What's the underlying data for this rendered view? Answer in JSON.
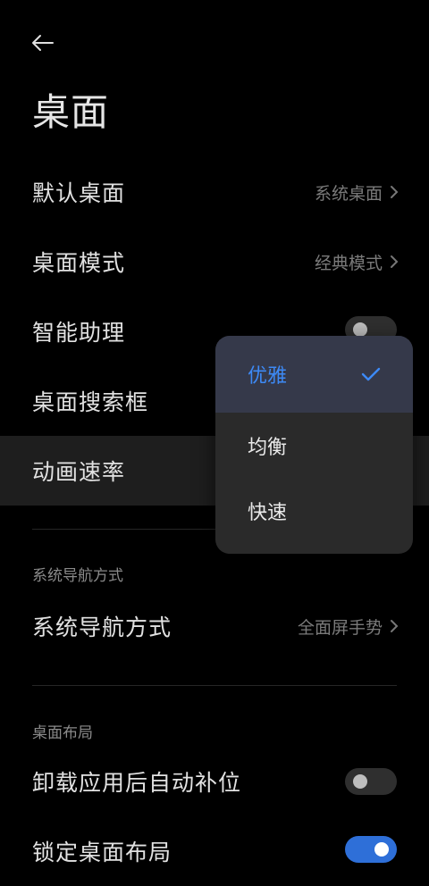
{
  "header": {
    "title": "桌面"
  },
  "settings": {
    "default_launcher": {
      "label": "默认桌面",
      "value": "系统桌面"
    },
    "launcher_mode": {
      "label": "桌面模式",
      "value": "经典模式"
    },
    "smart_assistant": {
      "label": "智能助理",
      "toggle_on": false
    },
    "search_bar": {
      "label": "桌面搜索框"
    },
    "animation_speed": {
      "label": "动画速率"
    }
  },
  "nav_section": {
    "header": "系统导航方式",
    "nav_mode": {
      "label": "系统导航方式",
      "value": "全面屏手势"
    }
  },
  "layout_section": {
    "header": "桌面布局",
    "auto_fill": {
      "label": "卸载应用后自动补位",
      "toggle_on": false
    },
    "lock_layout": {
      "label": "锁定桌面布局",
      "toggle_on": true
    }
  },
  "animation_popup": {
    "options": [
      "优雅",
      "均衡",
      "快速"
    ],
    "selected": "优雅"
  },
  "colors": {
    "accent": "#3d8af7",
    "toggle_on": "#2e6fd8",
    "background": "#000000"
  }
}
